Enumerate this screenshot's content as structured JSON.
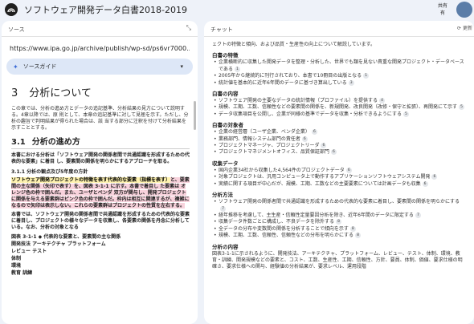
{
  "app": {
    "title": "ソフトウェア開発データ白書2018-2019",
    "share_label": "共有",
    "share_label_2": "有"
  },
  "source_panel": {
    "header": "ソース",
    "url": "https://www.ipa.go.jp/archive/publish/wp-sd/ps6vr7000...",
    "guide_label": "ソースガイド",
    "doc": {
      "h1_num": "3",
      "h1_text": "分析について",
      "intro": "この章では、分析の進め方とデータの追記基準、分析結果の見方について説明する。4章以降では、原 則として、本章の追記基準に対して見極を示す。ただし、分析の趣旨で判明結果が得られた場合は、該 当する部分に注釈を付けて分析結果を示すこととする。",
      "h2_num": "3.1",
      "h2_text": "分析の進め方",
      "bold_intro": "本書における分析は「ソフトウェア開発の関係者間で共通認識を形成するための代表的な要素」に着目 し、要素間の関係を明らかにするアプローチを取る。",
      "h3": "3.1.1 分析の観点及び5年度の方針",
      "p1a": "ソフトウェア開発プロジェクトの特徴を表す代表的な要素（指標を表す）",
      "p1b": "と、要素間の主な関係（矢印で表す）を、図表 3-1-1 に示す。本書で着目し た要素は オレンジ色の枠で囲んだ。また、ユーザとベンダ 双方が関与し、開発プロジェクトに関係を与える要素群はピンク色の枠で囲んだ。枠内は相互に関連するが、複雑になるので矢印は表示しない。これらの要素群はプロジェクトの性質を左右する。",
      "p2": "本書では、ソフトウェア開発の関係者間で共通認識を形成するための代表的な要素に着目し、プロジェクトの様々なデータを収集し、各要素の関係を丹念に分析している。なお、分析の対象となる",
      "figure_caption": "図表 3-1-1 ◆ 代表的な要素と、要素間の主な関係",
      "list": [
        "開発技法 アーキテクチャ プラットフォーム",
        "レビュー テスト",
        "体制",
        "環境",
        "教育 訓練"
      ]
    }
  },
  "chat_panel": {
    "header": "チャット",
    "update_label": "更新",
    "content": [
      {
        "type": "cont",
        "text": "ェクトの特徴と傾向、および品質・生産性の向上について解説しています。"
      },
      {
        "type": "sec",
        "text": "白書の特徴"
      },
      {
        "type": "item",
        "text": "企業横断的に収集した開発データを整理・分析した、世界でも類を見ない貴重な開発プロジェクト・データベースである",
        "cite": "1"
      },
      {
        "type": "item",
        "text": "2005年から継続的に刊行されており、本書で10冊目の出版となる",
        "cite": "1"
      },
      {
        "type": "item",
        "text": "統計値を基本的に近年6年間のデータに基づき算出している",
        "cite": "3"
      },
      {
        "type": "sec",
        "text": "白書の内容"
      },
      {
        "type": "item",
        "text": "ソフトウェア開発の主要なデータの統計情報（プロファイル）を提供する",
        "cite": "4"
      },
      {
        "type": "item",
        "text": "規模、工期、工数、信頼性などの要素間の関係を、新規開発、改良開発（改修・保守と拡張）、再開発にて示す",
        "cite": "5"
      },
      {
        "type": "item",
        "text": "データ収集項目を公開し、企業が同様の基準でデータを収集・分析できるようにする",
        "cite": "5"
      },
      {
        "type": "sec",
        "text": "白書の対象者"
      },
      {
        "type": "item",
        "text": "企業の経営層（ユーザ企業、ベンダ企業）",
        "cite": "6"
      },
      {
        "type": "item",
        "text": "業務部門、情報システム部門の責任者",
        "cite": "6"
      },
      {
        "type": "item",
        "text": "プロジェクトマネージャ、プロジェクトリーダ",
        "cite": "6"
      },
      {
        "type": "item",
        "text": "プロジェクトマネジメントオフィス、品質保証部門",
        "cite": "6"
      },
      {
        "type": "sec",
        "text": "収集データ"
      },
      {
        "type": "item",
        "text": "国内企業34社から収集した4,564件のプロジェクトデータ",
        "cite": "6"
      },
      {
        "type": "item",
        "text": "対象プロジェクトは、汎用コンピュータ上で動作するアプリケーションソフトウェアシステム開発",
        "cite": "6"
      },
      {
        "type": "item",
        "text": "実績に関する項目が中心だが、規模、工期、工数などの主要要素については計画データも収集",
        "cite": "6"
      },
      {
        "type": "sec",
        "text": "分析方法"
      },
      {
        "type": "item",
        "text": "ソフトウェア開発の関係者間で共通認識を形成するための代表的な要素に着目し、要素間の関係を明らかにする",
        "cite": "7"
      },
      {
        "type": "item",
        "text": "経年推移を考慮して、主生産・信頼性定量要因分析を除き、近年6年間のデータに限定する",
        "cite": "7"
      },
      {
        "type": "item",
        "text": "収集データ件数ごとに構成し、不良データを除外する",
        "cite": "8"
      },
      {
        "type": "item",
        "text": "全データの分布や変数間の関係を分析することで傾向を示す",
        "cite": "8"
      },
      {
        "type": "item",
        "text": "規模、工期、工数、信頼性、信頼性などの分布を明らかにする",
        "cite": "8"
      },
      {
        "type": "sec",
        "text": "分析の内容"
      },
      {
        "type": "plain",
        "text": "図表3-1-1に示されるように、開発技法、アーキテクチャ、プラットフォーム、レビュー、テスト、体制、環境、教育・訓練、開発規模などの要素と、コスト、工数、生産性、工期、信頼性、方針、要員、体制、価値、要求仕様の明確さ、要求仕様への関与、経験値の分析結果が、要求レベル、運用段階"
      }
    ]
  }
}
